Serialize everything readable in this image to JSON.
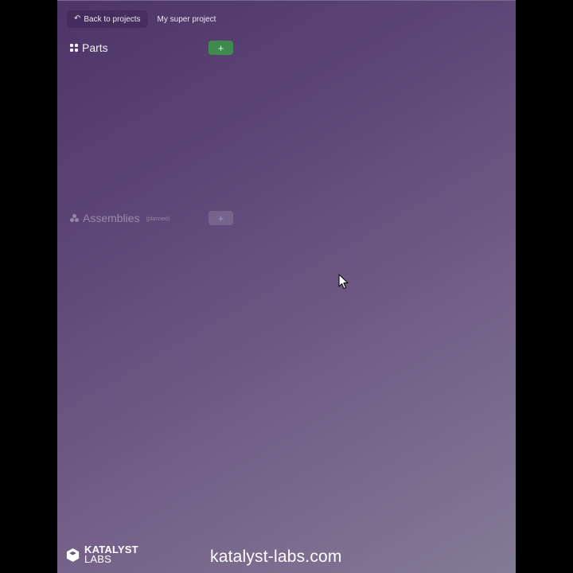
{
  "topbar": {
    "back_label": "Back to projects",
    "back_icon": "undo-arrow-icon",
    "project_name": "My super project"
  },
  "parts": {
    "title": "Parts",
    "icon": "grid-icon",
    "add_label": "+",
    "add_color": "#3f8a4c"
  },
  "assemblies": {
    "title": "Assemblies",
    "subtitle": "(planned)",
    "icon": "assembly-icon",
    "add_label": "+"
  },
  "overlay": {
    "brand_line1": "KATALYST",
    "brand_line2": "LABS",
    "website": "katalyst-labs.com"
  },
  "colors": {
    "background_start": "#4e3468",
    "background_end": "#827b96",
    "frame": "#000000"
  }
}
